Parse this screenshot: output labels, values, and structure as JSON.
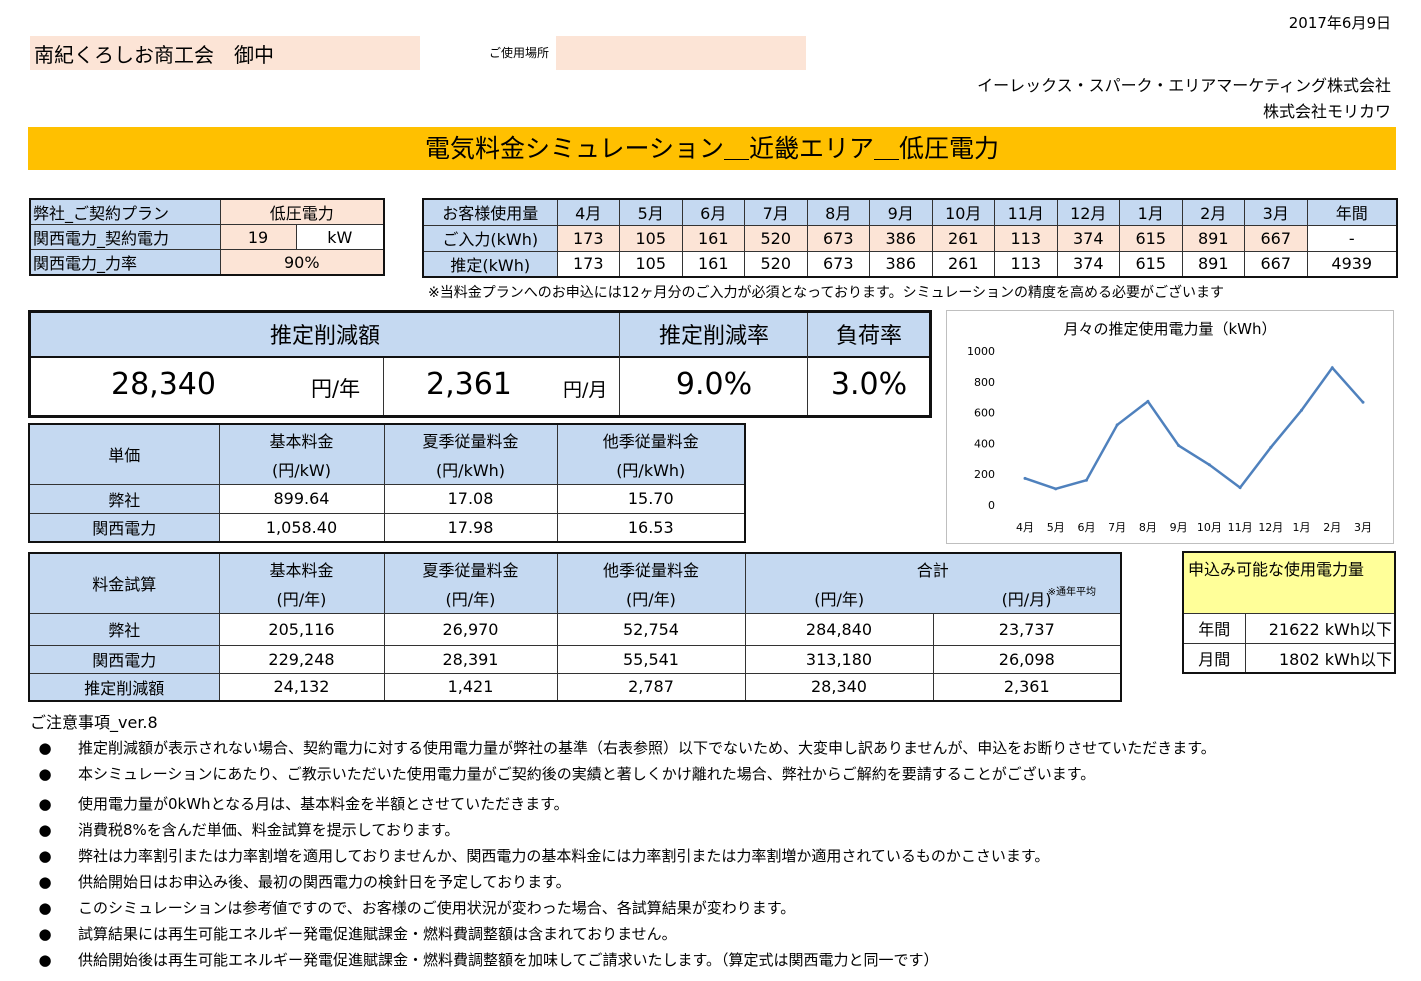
{
  "date": "2017年6月9日",
  "customer": "南紀くろしお商工会　御中",
  "location_label": "ご使用場所",
  "location_value": "",
  "company1": "イーレックス・スパーク・エリアマーケティング株式会社",
  "company2": "株式会社モリカワ",
  "title": "電気料金シミュレーション＿近畿エリア＿低圧電力",
  "plan": {
    "plan_label": "弊社_ご契約プラン",
    "plan_value": "低圧電力",
    "contract_label": "関西電力_契約電力",
    "contract_value": "19",
    "contract_unit": "kW",
    "pf_label": "関西電力_力率",
    "pf_value": "90%"
  },
  "usage": {
    "header_label": "お客様使用量",
    "months": [
      "4月",
      "5月",
      "6月",
      "7月",
      "8月",
      "9月",
      "10月",
      "11月",
      "12月",
      "1月",
      "2月",
      "3月"
    ],
    "annual_label": "年間",
    "input_label": "ご入力(kWh)",
    "input": [
      "173",
      "105",
      "161",
      "520",
      "673",
      "386",
      "261",
      "113",
      "374",
      "615",
      "891",
      "667"
    ],
    "input_annual": "-",
    "est_label": "推定(kWh)",
    "est": [
      "173",
      "105",
      "161",
      "520",
      "673",
      "386",
      "261",
      "113",
      "374",
      "615",
      "891",
      "667"
    ],
    "est_annual": "4939",
    "note": "※当料金プランへのお申込には12ヶ月分のご入力が必須となっております。シミュレーションの精度を高める必要がございます"
  },
  "summary": {
    "reduction_label": "推定削減額",
    "rate_label": "推定削減率",
    "load_label": "負荷率",
    "year_value": "28,340",
    "year_unit": "円/年",
    "month_value": "2,361",
    "month_unit": "円/月",
    "rate_value": "9.0%",
    "load_value": "3.0%"
  },
  "unit_price": {
    "label": "単価",
    "headers": [
      [
        "基本料金",
        "(円/kW)"
      ],
      [
        "夏季従量料金",
        "(円/kWh)"
      ],
      [
        "他季従量料金",
        "(円/kWh)"
      ]
    ],
    "rows": [
      {
        "name": "弊社",
        "values": [
          "899.64",
          "17.08",
          "15.70"
        ]
      },
      {
        "name": "関西電力",
        "values": [
          "1,058.40",
          "17.98",
          "16.53"
        ]
      }
    ]
  },
  "trial": {
    "label": "料金試算",
    "headers": [
      [
        "基本料金",
        "(円/年)"
      ],
      [
        "夏季従量料金",
        "(円/年)"
      ],
      [
        "他季従量料金",
        "(円/年)"
      ]
    ],
    "total_label": "合計",
    "total_year": "(円/年)",
    "total_month": "(円/月)",
    "avg_note": "※通年平均",
    "rows": [
      {
        "name": "弊社",
        "values": [
          "205,116",
          "26,970",
          "52,754",
          "284,840",
          "23,737"
        ]
      },
      {
        "name": "関西電力",
        "values": [
          "229,248",
          "28,391",
          "55,541",
          "313,180",
          "26,098"
        ]
      },
      {
        "name": "推定削減額",
        "values": [
          "24,132",
          "1,421",
          "2,787",
          "28,340",
          "2,361"
        ]
      }
    ]
  },
  "limits": {
    "title": "申込み可能な使用電力量",
    "rows": [
      {
        "label": "年間",
        "value": "21622 kWh以下"
      },
      {
        "label": "月間",
        "value": "1802 kWh以下"
      }
    ]
  },
  "notes_title": "ご注意事項_ver.8",
  "notes": [
    "推定削減額が表示されない場合、契約電力に対する使用電力量が弊社の基準（右表参照）以下でないため、大変申し訳ありませんが、申込をお断りさせていただきます。",
    "本シミュレーションにあたり、ご教示いただいた使用電力量がご契約後の実績と著しくかけ離れた場合、弊社からご解約を要請することがございます。",
    "使用電力量が0kWhとなる月は、基本料金を半額とさせていただきます。",
    "消費税8%を含んだ単価、料金試算を提示しております。",
    "弊社は力率割引または力率割増を適用しておりませんか、関西電力の基本料金には力率割引または力率割増か適用されているものかこさいます。",
    "供給開始日はお申込み後、最初の関西電力の検針日を予定しております。",
    "このシミュレーションは参考値ですので、お客様のご使用状況が変わった場合、各試算結果が変わります。",
    "試算結果には再生可能エネルギー発電促進賦課金・燃料費調整額は含まれておりません。",
    "供給開始後は再生可能エネルギー発電促進賦課金・燃料費調整額を加味してご請求いたします。（算定式は関西電力と同一です）"
  ],
  "chart_data": {
    "type": "line",
    "title": "月々の推定使用電力量（kWh）",
    "categories": [
      "4月",
      "5月",
      "6月",
      "7月",
      "8月",
      "9月",
      "10月",
      "11月",
      "12月",
      "1月",
      "2月",
      "3月"
    ],
    "values": [
      173,
      105,
      161,
      520,
      673,
      386,
      261,
      113,
      374,
      615,
      891,
      667
    ],
    "ylim": [
      0,
      1000
    ],
    "yticks": [
      0,
      200,
      400,
      600,
      800,
      1000
    ],
    "color": "#4f81bd",
    "grid": false
  }
}
